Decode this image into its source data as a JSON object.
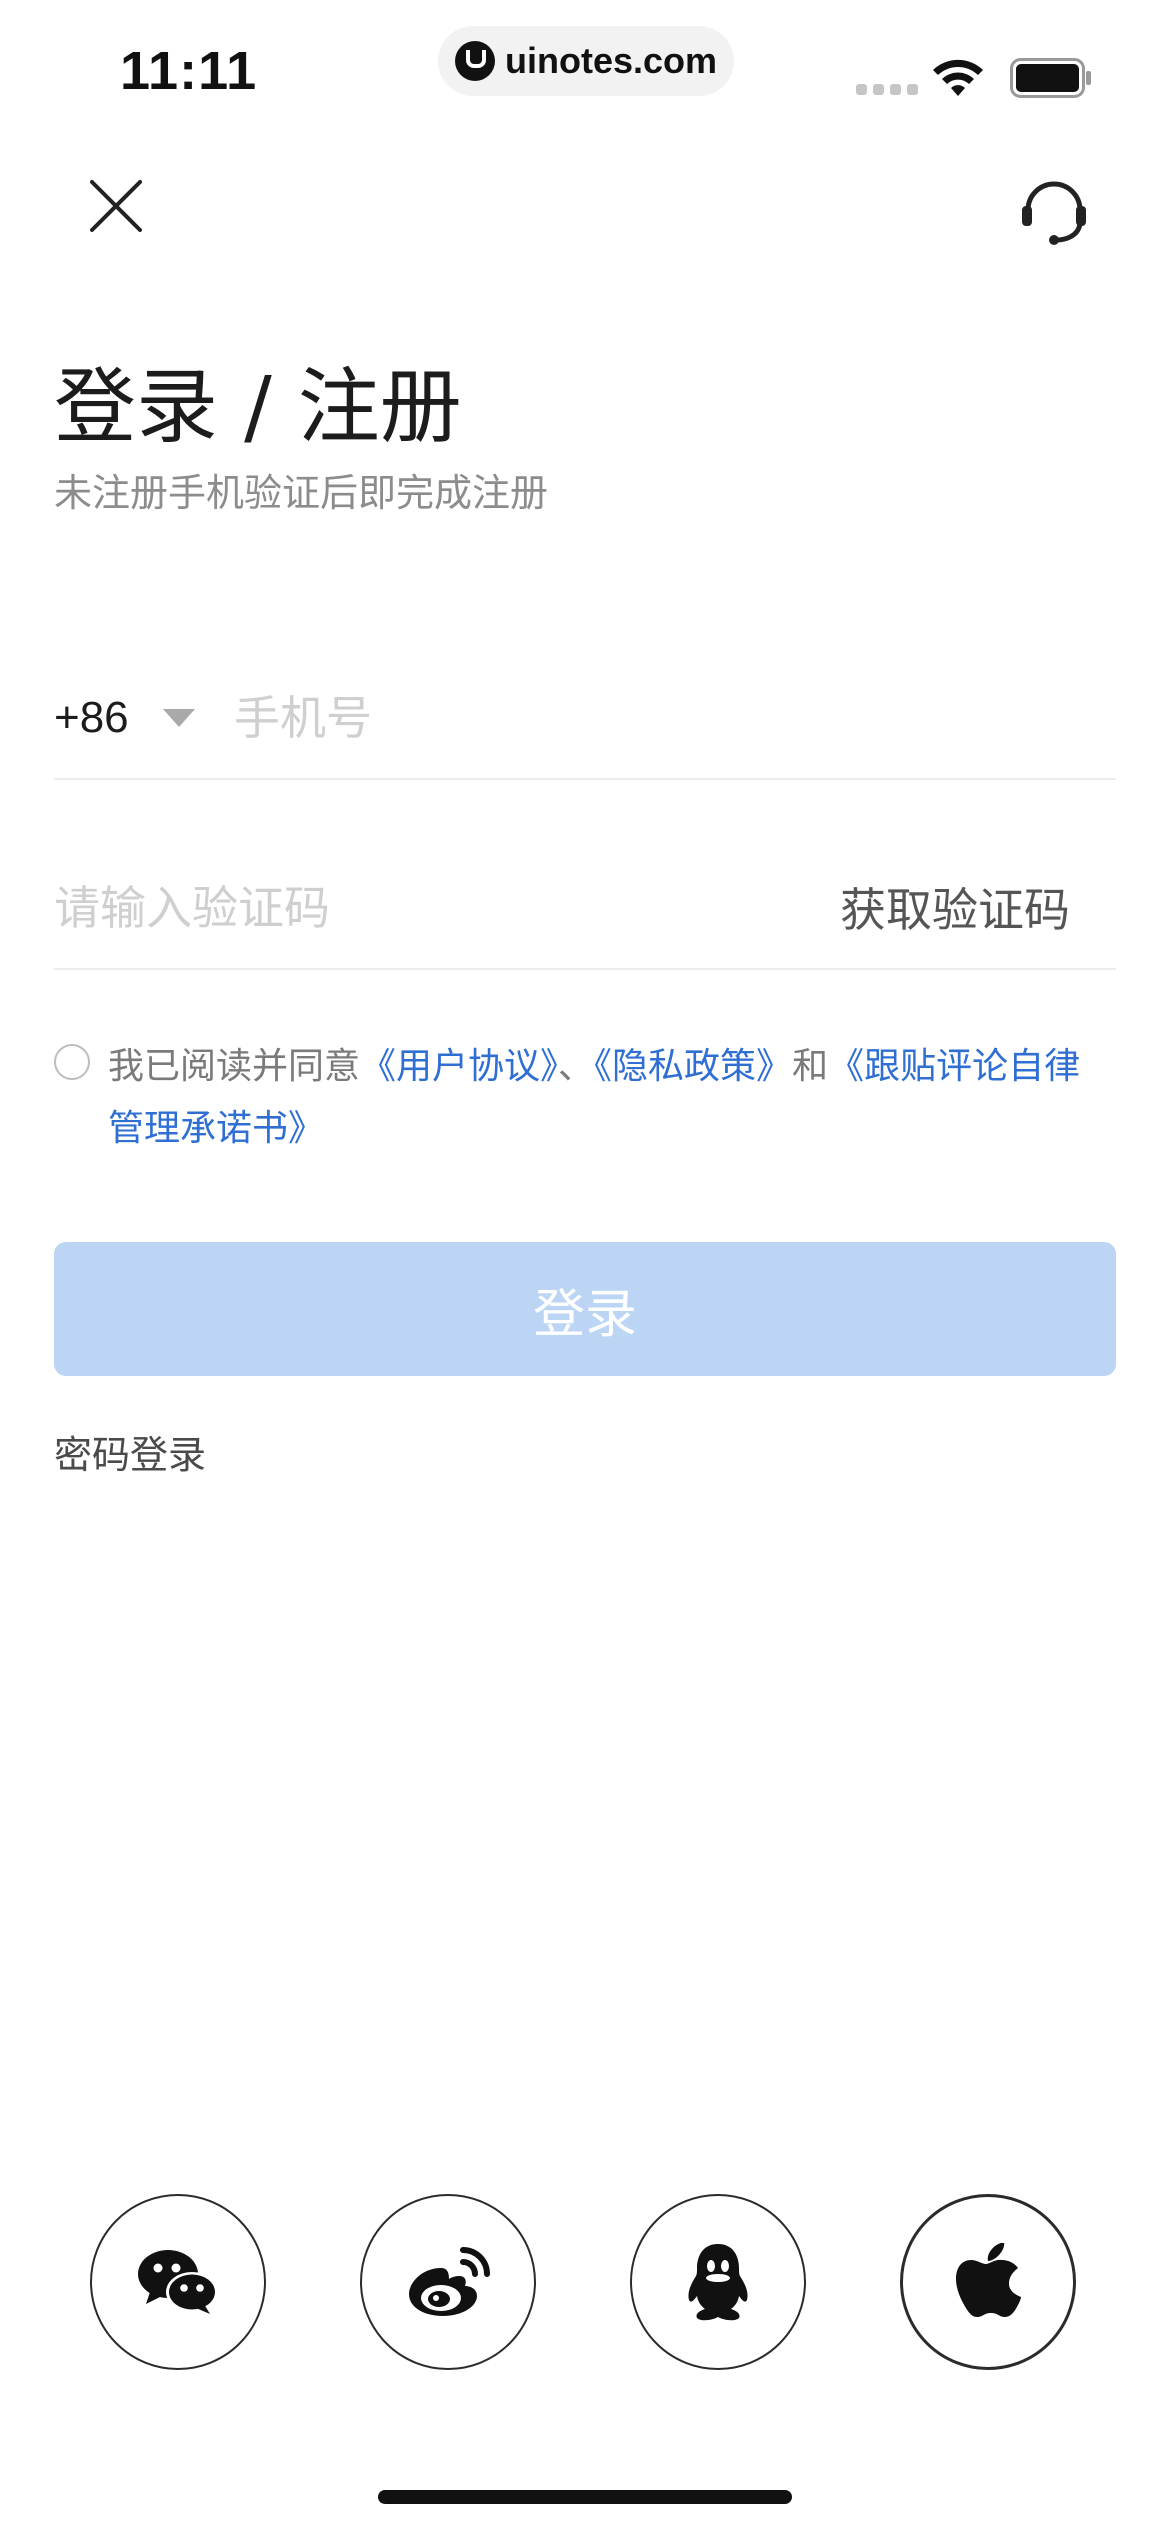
{
  "status_bar": {
    "time": "11:11",
    "url": "uinotes.com",
    "icons": [
      "signal-icon",
      "wifi-icon",
      "battery-icon"
    ]
  },
  "nav": {
    "close_icon": "close-icon",
    "support_icon": "headset-icon"
  },
  "title": "登录 / 注册",
  "subtitle": "未注册手机验证后即完成注册",
  "phone": {
    "country_code": "+86",
    "placeholder": "手机号",
    "value": ""
  },
  "code": {
    "placeholder": "请输入验证码",
    "value": "",
    "get_code_label": "获取验证码"
  },
  "agreement": {
    "checked": false,
    "prefix": "我已阅读并同意",
    "link_user": "《用户协议》",
    "sep1": "、",
    "link_privacy": "《隐私政策》",
    "conj": "和",
    "link_selfdiscipline": "《跟贴评论自律管理承诺书》"
  },
  "login_button_label": "登录",
  "password_login_label": "密码登录",
  "social_logins": [
    "wechat-icon",
    "weibo-icon",
    "qq-icon",
    "apple-icon"
  ],
  "colors": {
    "link": "#2f6fd3",
    "login_button_bg": "#bcd5f5",
    "placeholder": "#cfcfcf"
  }
}
